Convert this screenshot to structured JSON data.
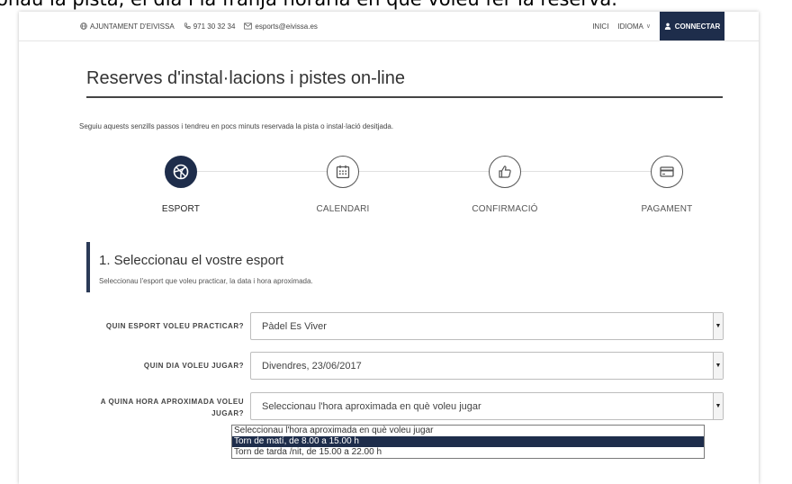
{
  "caption": "onau la pista, el dia i la franja horària en què voleu fer la reserva.",
  "topbar": {
    "ajuntament": "AJUNTAMENT D'EIVISSA",
    "phone": "971 30 32 34",
    "email": "esports@eivissa.es",
    "inici": "INICI",
    "idioma": "IDIOMA",
    "connect": "CONNECTAR"
  },
  "page": {
    "title": "Reserves d'instal·lacions i pistes on-line",
    "intro": "Seguiu aquests senzills passos i tendreu en pocs minuts reservada la pista o instal·lació desitjada."
  },
  "steps": [
    {
      "label": "ESPORT",
      "icon": "basketball-icon",
      "active": true
    },
    {
      "label": "CALENDARI",
      "icon": "calendar-icon",
      "active": false
    },
    {
      "label": "CONFIRMACIÓ",
      "icon": "thumbs-up-icon",
      "active": false
    },
    {
      "label": "PAGAMENT",
      "icon": "credit-card-icon",
      "active": false
    }
  ],
  "section": {
    "heading": "1. Seleccionau el vostre esport",
    "subtitle": "Seleccionau l'esport que voleu practicar, la data i hora aproximada."
  },
  "form": {
    "sport_label": "QUIN ESPORT VOLEU PRACTICAR?",
    "sport_value": "Pàdel Es Viver",
    "day_label": "QUIN DIA VOLEU JUGAR?",
    "day_value": "Divendres, 23/06/2017",
    "hour_label": "A QUINA HORA APROXIMADA VOLEU JUGAR?",
    "hour_value": "Seleccionau l'hora aproximada en què voleu jugar",
    "hour_options": [
      "Seleccionau l'hora aproximada en què voleu jugar",
      "Torn de matí, de 8.00 a 15.00 h",
      "Torn de tarda /nit, de 15.00 a 22.00 h"
    ],
    "highlighted_option": 1
  },
  "colors": {
    "accent": "#1e2d4b"
  }
}
